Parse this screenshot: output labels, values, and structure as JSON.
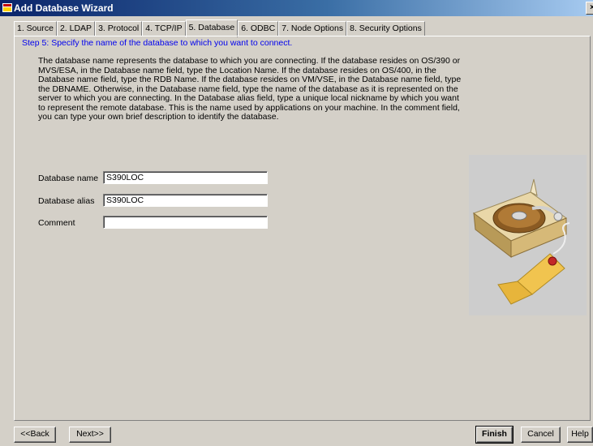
{
  "window": {
    "title": "Add Database Wizard",
    "close_glyph": "×"
  },
  "tabs": [
    {
      "label": "1. Source",
      "active": false
    },
    {
      "label": "2. LDAP",
      "active": false
    },
    {
      "label": "3. Protocol",
      "active": false
    },
    {
      "label": "4. TCP/IP",
      "active": false
    },
    {
      "label": "5. Database",
      "active": true
    },
    {
      "label": "6. ODBC",
      "active": false
    },
    {
      "label": "7. Node Options",
      "active": false
    },
    {
      "label": "8. Security Options",
      "active": false
    }
  ],
  "step": {
    "text": "Step 5: Specify the name of the database to which you want to connect."
  },
  "description": {
    "lines": [
      "The database name represents the database to which you are connecting.   If the database resides on OS/390 or",
      "MVS/ESA, in the Database name field, type the Location Name.   If the database resides on OS/400, in the",
      "Database name field, type the RDB Name.   If the database resides on VM/VSE, in the Database name field, type",
      "the DBNAME.   Otherwise, in the Database name field, type the name of the database as it is represented on the",
      "server to which you are connecting.   In the Database alias field, type a unique local nickname by which you want",
      "to represent the remote database.   This is the name used by applications on your machine.   In the comment field,",
      "you can type your own brief description to identify the database."
    ]
  },
  "form": {
    "db_name_label": "Database name",
    "db_name_value": "S390LOC",
    "db_alias_label": "Database alias",
    "db_alias_value": "S390LOC",
    "comment_label": "Comment",
    "comment_value": ""
  },
  "buttons": {
    "back": "<<Back",
    "next": "Next>>",
    "finish": "Finish",
    "cancel": "Cancel",
    "help": "Help"
  },
  "colors": {
    "title_bar": "#0a246a",
    "step_text": "#0000ee",
    "face": "#d4d0c8"
  }
}
